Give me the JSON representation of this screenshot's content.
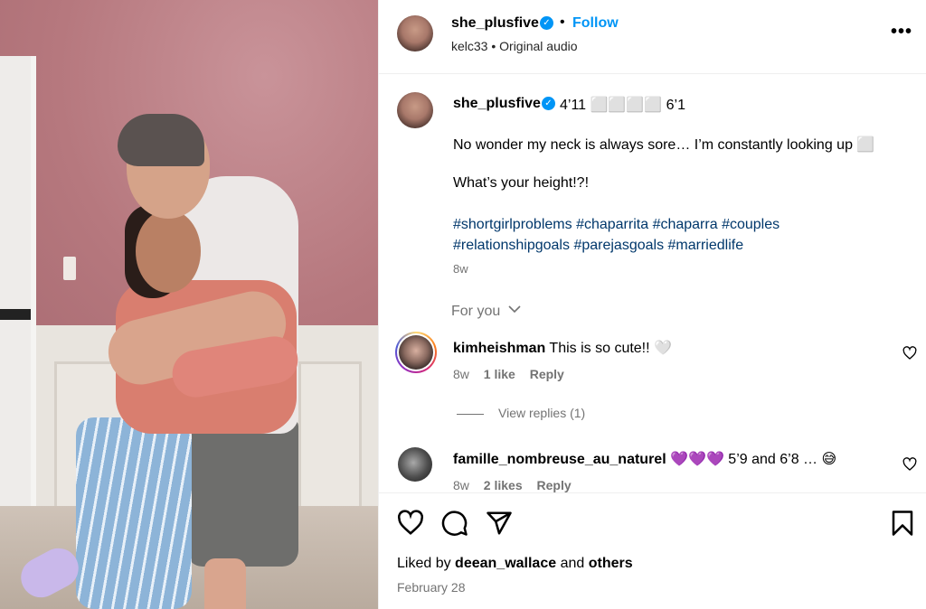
{
  "post": {
    "username": "she_plusfive",
    "verified_mark": "✓",
    "dot": "•",
    "follow_label": "Follow",
    "audio": "kelc33 • Original audio",
    "more_label": "•••"
  },
  "caption": {
    "username": "she_plusfive",
    "heights": "4’11 ⬜⬜⬜⬜ 6’1",
    "line1": "No wonder my neck is always sore… I’m constantly looking up ⬜",
    "line2": "What’s your height!?!",
    "hashtags": [
      "#shortgirlproblems",
      "#chaparrita",
      "#chaparra",
      "#couples",
      "#relationshipgoals",
      "#parejasgoals",
      "#marriedlife"
    ],
    "age": "8w"
  },
  "for_you": "For you",
  "comments": [
    {
      "username": "kimheishman",
      "text": "This is so cute!! 🤍",
      "age": "8w",
      "likes": "1 like",
      "reply": "Reply",
      "view_replies": "View replies (1)"
    },
    {
      "username": "famille_nombreuse_au_naturel",
      "text": "💜💜💜 5’9 and 6’8 … 😅",
      "age": "8w",
      "likes": "2 likes",
      "reply": "Reply"
    }
  ],
  "footer": {
    "liked_prefix": "Liked by",
    "liked_user": "deean_wallace",
    "liked_and": "and",
    "liked_others": "others",
    "date": "February 28"
  },
  "colors": {
    "accent": "#0095f6",
    "hashtag": "#00376b",
    "muted": "#737373",
    "border": "#efefef"
  },
  "icons": [
    "verified-icon",
    "more-icon",
    "heart-icon",
    "comment-icon",
    "share-icon",
    "bookmark-icon",
    "chevron-down-icon"
  ]
}
